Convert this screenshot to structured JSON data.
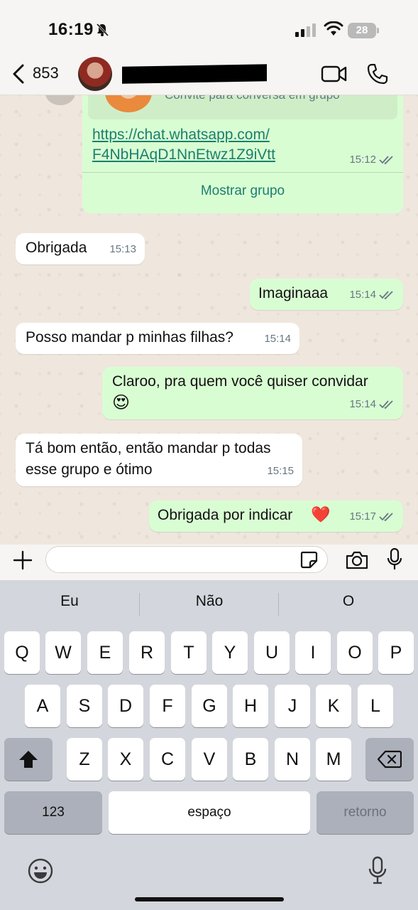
{
  "status_bar": {
    "time": "16:19",
    "battery": "28"
  },
  "header": {
    "back_count": "853"
  },
  "chat": {
    "group_invite": {
      "subtitle": "Convite para conversa em grupo",
      "link_line1": "https://chat.whatsapp.com/",
      "link_line2": "F4NbHAqD1NnEtwz1Z9iVtt",
      "time": "15:12",
      "action": "Mostrar grupo"
    },
    "messages": [
      {
        "dir": "in",
        "text": "Obrigada",
        "time": "15:13"
      },
      {
        "dir": "out",
        "text": "Imaginaaa",
        "time": "15:14"
      },
      {
        "dir": "in",
        "text": "Posso mandar p minhas filhas?",
        "time": "15:14"
      },
      {
        "dir": "out",
        "text": "Claroo, pra quem você quiser convidar",
        "emoji": "😍",
        "time": "15:14"
      },
      {
        "dir": "in",
        "text_line1": "Tá bom então, então mandar p todas",
        "text_line2": "esse grupo e ótimo",
        "time": "15:15"
      },
      {
        "dir": "out",
        "text": "Obrigada por indicar",
        "emoji": "❤️",
        "time": "15:17"
      }
    ]
  },
  "keyboard": {
    "suggestions": [
      "Eu",
      "Não",
      "O"
    ],
    "row1": [
      "Q",
      "W",
      "E",
      "R",
      "T",
      "Y",
      "U",
      "I",
      "O",
      "P"
    ],
    "row2": [
      "A",
      "S",
      "D",
      "F",
      "G",
      "H",
      "J",
      "K",
      "L"
    ],
    "row3": [
      "Z",
      "X",
      "C",
      "V",
      "B",
      "N",
      "M"
    ],
    "numbers_key": "123",
    "space_key": "espaço",
    "return_key": "retorno"
  },
  "icons": [
    "mute-bell-icon",
    "signal-icon",
    "wifi-icon",
    "battery-icon",
    "back-chevron-icon",
    "video-call-icon",
    "phone-call-icon",
    "plus-icon",
    "sticker-icon",
    "camera-icon",
    "microphone-icon",
    "shift-icon",
    "backspace-icon",
    "emoji-icon",
    "dictation-mic-icon"
  ]
}
